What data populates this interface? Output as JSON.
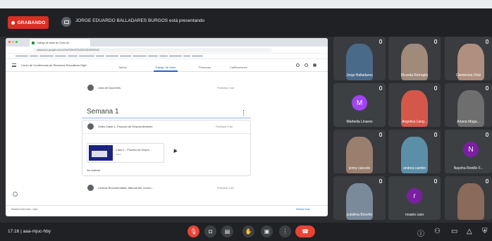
{
  "recording": {
    "label": "GRABANDO"
  },
  "presenter": {
    "text": "JORGE EDUARDO BALLADARES BURGOS está presentando"
  },
  "shared": {
    "tab_title": "Trabajo de clase de Curso de...",
    "url": "classroom.google.com/u/0/w/NDkxNTk4MDU5NDM4/t/all",
    "class_name": "Curso de Conferencia de Recursos Educativos Digit...",
    "tabs": [
      "Tablón",
      "Trabajo de clase",
      "Personas",
      "Calificaciones"
    ],
    "items": {
      "lista": {
        "text": "Lista de Docentes",
        "date": "Publicado 3 abr"
      },
      "section_title": "Semana 1",
      "card_title": {
        "text": "Video Clase 1: Proceso de Emprendimiento",
        "date": "Publicado 5 abr"
      },
      "attachment_title": "Clase 1 - Proceso de Empre...",
      "attachment_sub": "Video",
      "ver_material": "Ver material",
      "bottom_item": {
        "text": "Lectura Recomendada: Manual del Curren...",
        "date": "Publicado 5 abr"
      }
    },
    "download": "Mostrar todo todo - mp4",
    "download_right": "Mostrar todo"
  },
  "participants": [
    {
      "name": "Jorge Balladares",
      "type": "photo",
      "color": "#4a6a8a"
    },
    {
      "name": "Ricarda Remaplo",
      "type": "photo",
      "color": "#a08a7a"
    },
    {
      "name": "Clemencia Ortiz",
      "type": "photo",
      "color": "#b08f80"
    },
    {
      "name": "Marbelia Linares",
      "type": "avatar",
      "initial": "M",
      "color": "#a142f4"
    },
    {
      "name": "Angelica Lang...",
      "type": "photo",
      "color": "#d4584a"
    },
    {
      "name": "Ariana Maga...",
      "type": "photo",
      "color": "#6e6e6e"
    },
    {
      "name": "jenny caicedo",
      "type": "photo",
      "color": "#9a7f6f"
    },
    {
      "name": "andrea cambo",
      "type": "photo",
      "color": "#5b8fa8"
    },
    {
      "name": "Naysha Ronillo F...",
      "type": "avatar",
      "initial": "N",
      "color": "#7b1fa2"
    },
    {
      "name": "zulalima Briceño",
      "type": "photo",
      "color": "#7a8a9a"
    },
    {
      "name": "rosario caro",
      "type": "avatar",
      "initial": "r",
      "color": "#7b1fa2"
    },
    {
      "name": "",
      "type": "photo",
      "color": "#8a6a5a"
    }
  ],
  "meeting": {
    "time": "17:16",
    "separator": "|",
    "code": "aaa-mjuc-hby"
  }
}
